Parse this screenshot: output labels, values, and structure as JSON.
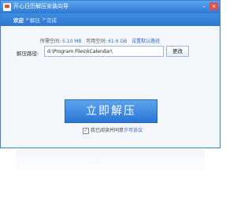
{
  "window": {
    "title": "开心日历解压安装向导"
  },
  "breadcrumb": {
    "step1": "欢迎",
    "sep1": ">",
    "step2": "解压",
    "sep2": ">",
    "step3": "完成"
  },
  "space_info": {
    "required_label": "所需空间:",
    "required_value": "5.10 MB",
    "available_label": "可用空间:",
    "available_value": "61.6 GB",
    "shortcut_link": "设置默认路径"
  },
  "path": {
    "label": "解压路径:",
    "value": "d:\\Program Files\\kCalendar\\",
    "change_button": "更改"
  },
  "main": {
    "extract_button": "立即解压"
  },
  "agreement": {
    "text": "我已阅读并同意",
    "link": "许可协议",
    "checked": true
  }
}
